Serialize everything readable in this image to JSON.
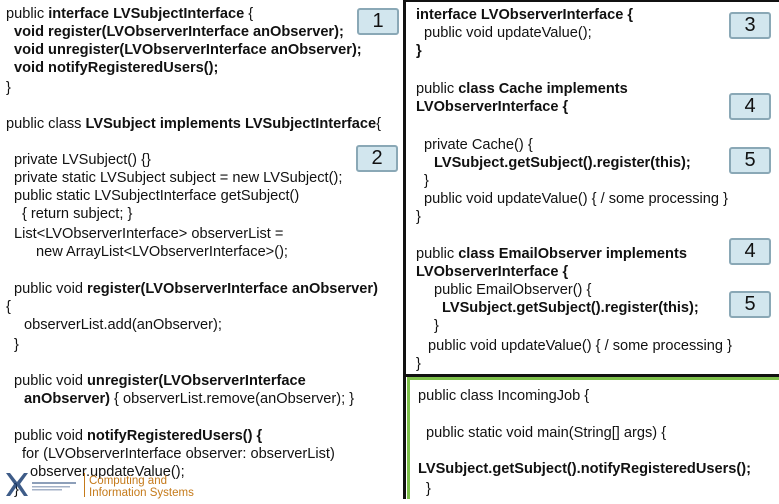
{
  "left": {
    "l1a": "public ",
    "l1b": "interface LVSubjectInterface",
    "l1c": " {",
    "l2": "void register(LVObserverInterface anObserver);",
    "l3": "void unregister(LVObserverInterface anObserver);",
    "l4": "void notifyRegisteredUsers();",
    "l5": "}",
    "l6a": "public class ",
    "l6b": "LVSubject implements LVSubjectInterface",
    "l6c": "{",
    "l7": "private LVSubject() {}",
    "l8": "private static LVSubject subject = new LVSubject();",
    "l9": "public static LVSubjectInterface getSubject()",
    "l10": "{ return subject; }",
    "l11": "List<LVObserverInterface> observerList =",
    "l12": "new ArrayList<LVObserverInterface>();",
    "l13a": "public void ",
    "l13b": "register(LVObserverInterface anObserver)",
    "l14": "{",
    "l15": "observerList.add(anObserver);",
    "l16": "}",
    "l17a": "public void ",
    "l17b": "unregister(LVObserverInterface",
    "l18a": "anObserver)",
    "l18b": " { observerList.remove(anObserver); }",
    "l19a": "public void ",
    "l19b": "notifyRegisteredUsers() {",
    "l20": "for (LVObserverInterface observer: observerList)",
    "l21": "observer.updateValue();",
    "l22": "}"
  },
  "right": {
    "r1": "interface LVObserverInterface {",
    "r2": "public void updateValue();",
    "r3": "}",
    "r4a": "public ",
    "r4b": "class Cache implements",
    "r5": "LVObserverInterface {",
    "r6": "private Cache() {",
    "r7": "LVSubject.getSubject().register(this);",
    "r8": "}",
    "r9": "public void updateValue() { / some processing }",
    "r10": "}",
    "r11a": "public ",
    "r11b": "class EmailObserver implements",
    "r12": "LVObserverInterface {",
    "r13": "public EmailObserver() {",
    "r14": "LVSubject.getSubject().register(this);",
    "r15": "}",
    "r16": "public void updateValue() { / some processing }",
    "r17": "}"
  },
  "bottom": {
    "b1": "public class IncomingJob {",
    "b2": "public static void main(String[] args) {",
    "b3": "LVSubject.getSubject().notifyRegisteredUsers();",
    "b4": "}"
  },
  "badges": {
    "b1": "1",
    "b2": "2",
    "b3": "3",
    "b4a": "4",
    "b4b": "4",
    "b5a": "5",
    "b5b": "5"
  },
  "logo": {
    "line1": "Computing and",
    "line2": "Information Systems"
  }
}
